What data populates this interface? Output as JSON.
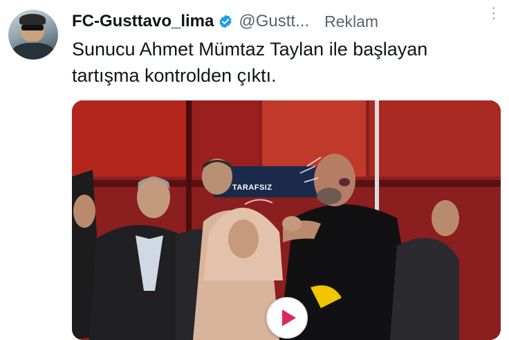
{
  "tweet": {
    "display_name": "FC-Gusttavo_lima",
    "handle": "@Gustt...",
    "ad_label": "Reklam",
    "text": "Sunucu Ahmet Mümtaz Taylan ile başlayan tartışma kontrolden çıktı.",
    "verified": true
  },
  "media": {
    "type": "video",
    "studio_label": "TARAFSIZ"
  },
  "colors": {
    "verified_badge": "#1d9bf0",
    "secondary_text": "#536471",
    "play_icon": "#e0245e",
    "studio_red": "#b3261e"
  },
  "icons": {
    "verified": "verified-badge-icon",
    "more": "more-options-icon",
    "play": "play-icon"
  }
}
